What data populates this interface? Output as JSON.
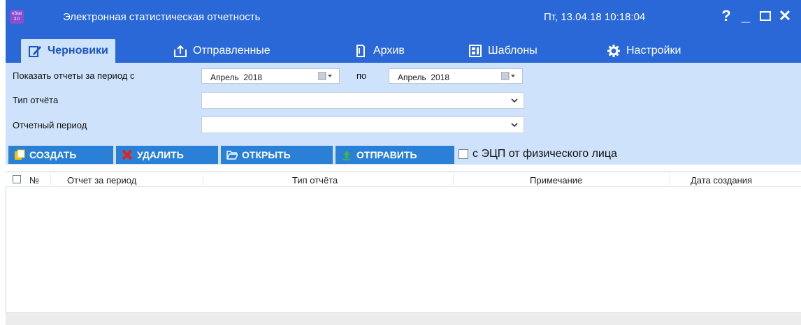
{
  "window": {
    "title": "Электронная статистическая отчетность",
    "logo_text": "eStat 3.0",
    "datetime": "Пт, 13.04.18 10:18:04",
    "controls": {
      "help": "?",
      "minimize": "_",
      "close": "✕"
    }
  },
  "tabs": [
    {
      "label": "Черновики",
      "icon": "pencil-icon",
      "active": true
    },
    {
      "label": "Отправленные",
      "icon": "upload-icon",
      "active": false
    },
    {
      "label": "Архив",
      "icon": "archive-icon",
      "active": false
    },
    {
      "label": "Шаблоны",
      "icon": "template-icon",
      "active": false
    },
    {
      "label": "Настройки",
      "icon": "gear-icon",
      "active": false
    }
  ],
  "filters": {
    "period_label": "Показать отчеты за период с",
    "period_from": "Апрель  2018",
    "period_to_label": "по",
    "period_to": "Апрель  2018",
    "report_type_label": "Тип отчёта",
    "report_type_value": "",
    "reporting_period_label": "Отчетный период",
    "reporting_period_value": ""
  },
  "toolbar": {
    "create_label": "СОЗДАТЬ",
    "delete_label": "УДАЛИТЬ",
    "open_label": "ОТКРЫТЬ",
    "send_label": "ОТПРАВИТЬ",
    "signature_checkbox_label": "с ЭЦП от физического лица",
    "signature_checked": false
  },
  "table": {
    "columns": [
      "№",
      "Отчет за период",
      "Тип отчёта",
      "Примечание",
      "Дата создания"
    ],
    "rows": []
  },
  "colors": {
    "titlebar": "#2a68d8",
    "filter_panel": "#cfe2fb",
    "button": "#2a7fd6",
    "delete_icon": "#e2231a",
    "create_icon": "#f5c400",
    "send_icon": "#3bb54a"
  }
}
